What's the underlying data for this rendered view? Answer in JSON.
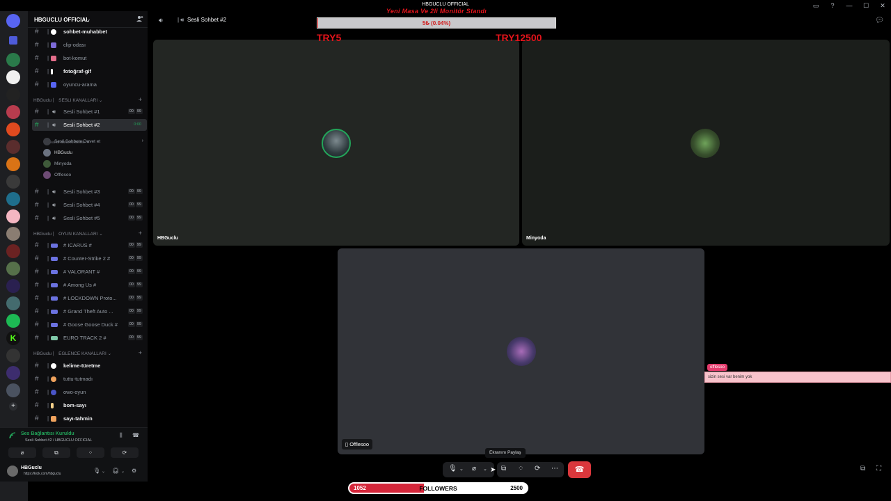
{
  "window": {
    "title": "HBGUCLU OFFICIAL",
    "controls": [
      "▭",
      "?",
      "—",
      "☐",
      "✕"
    ]
  },
  "server": {
    "name": "HBGUCLU OFFICIAL",
    "chevron": "⌄"
  },
  "channels_top": [
    {
      "label": "sohbet-muhabbet",
      "bold": true,
      "emoji_color": "#ffffff"
    },
    {
      "label": "clip-odası",
      "bold": false,
      "emoji_color": "#7d6bd8"
    },
    {
      "label": "bot-komut",
      "bold": false,
      "emoji_color": "#e36d8a"
    },
    {
      "label": "fotoğraf-gif",
      "bold": true,
      "emoji_color": "#ffffff"
    },
    {
      "label": "oyuncu-arama",
      "bold": false,
      "emoji_color": "#5865f2"
    }
  ],
  "categories": {
    "voice": "HBGuclu ⎸ SESLI KANALLARI ⌄",
    "games": "HBGuclu ⎸ OYUN KANALLARI ⌄",
    "fun": "HBGuclu ⎸ EGLENCE KANALLARI ⌄"
  },
  "voice_channels": [
    {
      "label": "Sesli Sohbet #1",
      "b1": "00",
      "b2": "99"
    },
    {
      "label": "Sesli Sohbet #2",
      "b1": "",
      "b2": "0:00"
    },
    {
      "label": "Sesli Sohbet #3",
      "b1": "00",
      "b2": "99"
    },
    {
      "label": "Sesli Sohbet #4",
      "b1": "00",
      "b2": "99"
    },
    {
      "label": "Sesli Sohbet #5",
      "b1": "00",
      "b2": "99"
    }
  ],
  "voice_sub": "Bir kanal durumu belirle ✎",
  "voice_members": [
    {
      "name": "Sesli Sohbete Davet et",
      "color": "#3a3c42",
      "chev": "›"
    },
    {
      "name": "HBGuclu",
      "color": "#6b7280",
      "chev": ""
    },
    {
      "name": "Minyoda",
      "color": "#3f5a3a",
      "chev": ""
    },
    {
      "name": "Offlesoo",
      "color": "#6d4b74",
      "chev": ""
    }
  ],
  "game_channels": [
    {
      "label": "# ICARUS #"
    },
    {
      "label": "# Counter-Strike 2 #"
    },
    {
      "label": "# VALORANT #"
    },
    {
      "label": "# Among Us #"
    },
    {
      "label": "# LOCKDOWN Proto..."
    },
    {
      "label": "# Grand Theft Auto ..."
    },
    {
      "label": "# Goose Goose Duck #"
    },
    {
      "label": "EURO TRACK 2 #"
    }
  ],
  "game_badges": [
    "00",
    "99"
  ],
  "fun_channels": [
    {
      "label": "kelime-türetme",
      "bold": true,
      "emoji_color": "#ffffff"
    },
    {
      "label": "tuttu-tutmadı",
      "bold": false,
      "emoji_color": "#f0a35e"
    },
    {
      "label": "owo-oyun",
      "bold": false,
      "emoji_color": "#4a55c8"
    },
    {
      "label": "bom-sayı",
      "bold": true,
      "emoji_color": "#f5d08a"
    },
    {
      "label": "sayı-tahmin",
      "bold": true,
      "emoji_color": "#f0a35e"
    }
  ],
  "voice_panel": {
    "status": "Ses Bağlantısı Kuruldu",
    "sub": "Sesli Sohbet #2 / HBGUCLU OFFICIAL",
    "buttons": [
      "⌀",
      "⧉",
      "⁘",
      "⟳"
    ]
  },
  "user_panel": {
    "name": "HBGuclu",
    "status": "https://kick.com/hbguclu"
  },
  "call": {
    "title": "Sesli Sohbet #2",
    "participants": [
      {
        "name": "HBGuclu"
      },
      {
        "name": "Minyoda"
      },
      {
        "name": "Offlesoo"
      }
    ],
    "tooltip": "Ekranını Paylaş"
  },
  "stream_overlay": {
    "goal_title": "Yeni Masa Ve 2li Monitör Standı",
    "goal_progress_text": "5₺ (0.04%)",
    "goal_progress_fraction": 0.0004,
    "goal_min": "TRY5",
    "goal_max": "TRY12500",
    "chat_user": "offlesoo",
    "chat_message": "sizin sesi var benim yok"
  },
  "followers": {
    "current": "1052",
    "label": "FOLLOWERS",
    "goal": "2500",
    "fraction": 0.4208
  },
  "colors": {
    "accent": "#5865f2",
    "online": "#23a55a",
    "danger": "#da373c",
    "overlay_red": "#e4141b"
  }
}
